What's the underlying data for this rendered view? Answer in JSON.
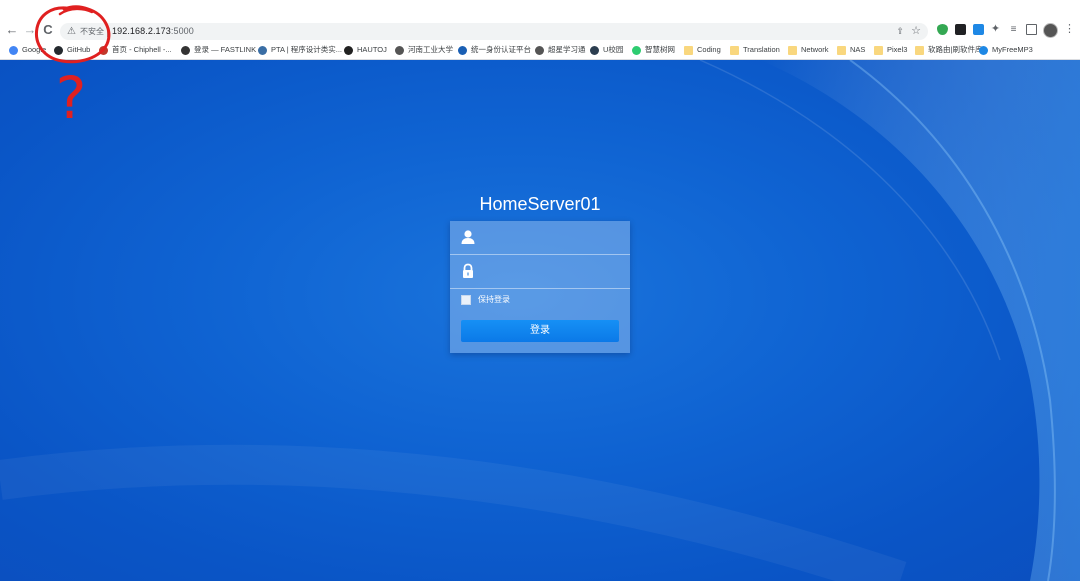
{
  "browser": {
    "nav": {
      "back_glyph": "←",
      "forward_glyph": "→",
      "reload_glyph": "C"
    },
    "omnibox": {
      "security_label": "不安全",
      "url_host": "192.168.2.173",
      "url_port": ":5000"
    },
    "bookmarks": [
      {
        "label": "Google",
        "icon": "google-icon",
        "color": "#4285f4"
      },
      {
        "label": "GitHub",
        "icon": "github-icon",
        "color": "#24292e"
      },
      {
        "label": "首页 - Chiphell -...",
        "icon": "chiphell-icon",
        "color": "#c0392b"
      },
      {
        "label": "登录 — FASTLINK",
        "icon": "fastlink-icon",
        "color": "#333333"
      },
      {
        "label": "PTA | 程序设计类实...",
        "icon": "pta-icon",
        "color": "#3a6ea5"
      },
      {
        "label": "HAUTOJ",
        "icon": "hautoj-icon",
        "color": "#222222"
      },
      {
        "label": "河南工业大学",
        "icon": "globe-icon",
        "color": "#555555"
      },
      {
        "label": "统一身份认证平台",
        "icon": "auth-icon",
        "color": "#1a5fb4"
      },
      {
        "label": "超星学习通",
        "icon": "globe-icon",
        "color": "#555555"
      },
      {
        "label": "U校园",
        "icon": "u-icon",
        "color": "#2c3e50"
      },
      {
        "label": "智慧树网",
        "icon": "zhihuishu-icon",
        "color": "#2ecc71"
      },
      {
        "label": "Coding",
        "icon": "folder-icon",
        "color": "#f9d77e"
      },
      {
        "label": "Translation",
        "icon": "folder-icon",
        "color": "#f9d77e"
      },
      {
        "label": "Network",
        "icon": "folder-icon",
        "color": "#f9d77e"
      },
      {
        "label": "NAS",
        "icon": "folder-icon",
        "color": "#f9d77e"
      },
      {
        "label": "Pixel3",
        "icon": "folder-icon",
        "color": "#f9d77e"
      },
      {
        "label": "软路由|刷软件库",
        "icon": "folder-icon",
        "color": "#f9d77e"
      },
      {
        "label": "MyFreeMP3",
        "icon": "music-icon",
        "color": "#1e88e5"
      }
    ]
  },
  "login": {
    "server_name": "HomeServer01",
    "username": "",
    "password": "",
    "remember_label": "保持登录",
    "submit_label": "登录"
  },
  "annotation": {
    "mark": "?",
    "color": "#e02020"
  },
  "colors": {
    "page_bg": "#0f63d2",
    "button": "#0b79e8"
  }
}
